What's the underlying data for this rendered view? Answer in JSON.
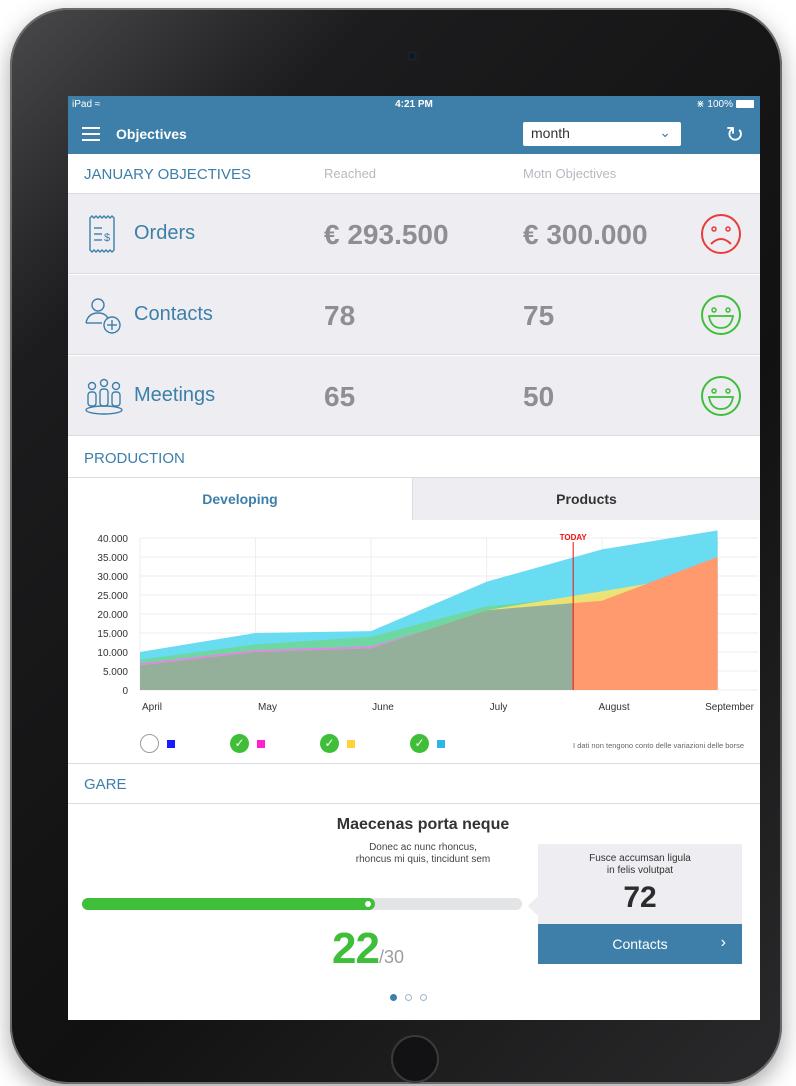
{
  "status_bar": {
    "device": "iPad",
    "time": "4:21 PM",
    "battery": "100%"
  },
  "nav": {
    "title": "Objectives",
    "period_select": "month"
  },
  "objectives": {
    "header": "JANUARY OBJECTIVES",
    "col_reached": "Reached",
    "col_objectives": "Motn Objectives",
    "rows": [
      {
        "label": "Orders",
        "reached": "€ 293.500",
        "objective": "€ 300.000",
        "mood": "sad",
        "icon": "receipt-icon"
      },
      {
        "label": "Contacts",
        "reached": "78",
        "objective": "75",
        "mood": "happy",
        "icon": "add-contact-icon"
      },
      {
        "label": "Meetings",
        "reached": "65",
        "objective": "50",
        "mood": "happy",
        "icon": "meeting-people-icon"
      }
    ]
  },
  "production": {
    "header": "PRODUCTION",
    "tabs": [
      "Developing",
      "Products"
    ],
    "active_tab": "Developing",
    "legend_note": "I dati non tengono conto delle variazioni delle borse"
  },
  "chart_data": {
    "type": "area",
    "x": [
      "April",
      "May",
      "June",
      "July",
      "August",
      "September"
    ],
    "ylim": [
      0,
      40000
    ],
    "yticks": [
      "40.000",
      "35.000",
      "30.000",
      "25.000",
      "20.000",
      "15.000",
      "10.000",
      "5.000",
      "0"
    ],
    "today_label": "TODAY",
    "today_x": 3.75,
    "series": [
      {
        "color": "#59d8f0",
        "values": [
          10000,
          15000,
          15500,
          28500,
          37000,
          42000
        ]
      },
      {
        "color": "#6fd79a",
        "values": [
          8000,
          12000,
          14000,
          22000,
          25000,
          30000
        ]
      },
      {
        "color": "#f47bf4",
        "values": [
          7000,
          10500,
          11500,
          20500,
          23500,
          35000
        ]
      },
      {
        "color": "#f7e36e",
        "values": [
          6500,
          10000,
          11000,
          21000,
          26000,
          31000
        ]
      },
      {
        "color": "#ff9a6e",
        "values": [
          6500,
          10000,
          11000,
          21000,
          23500,
          35000
        ]
      }
    ],
    "legend": [
      {
        "checked": false,
        "square_color": "#1a1aff"
      },
      {
        "checked": true,
        "square_color": "#ff22cc"
      },
      {
        "checked": true,
        "square_color": "#ffd23a"
      },
      {
        "checked": true,
        "square_color": "#2bb6e8"
      }
    ]
  },
  "gare": {
    "header": "GARE",
    "title": "Maecenas porta neque",
    "subtitle_l1": "Donec ac nunc rhoncus,",
    "subtitle_l2": "rhoncus mi quis, tincidunt sem",
    "progress": 0.667,
    "score": "22",
    "score_total": "/30",
    "callout_l1": "Fusce accumsan ligula",
    "callout_l2": "in felis volutpat",
    "callout_value": "72",
    "cta": "Contacts",
    "page_index": 0,
    "page_count": 3
  }
}
